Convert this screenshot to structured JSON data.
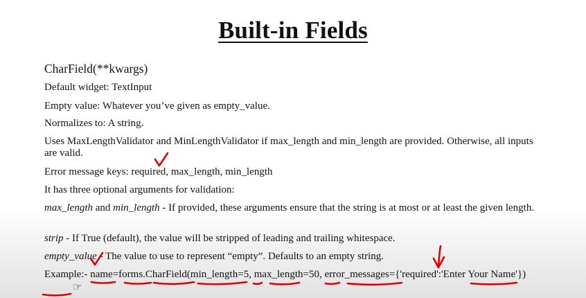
{
  "title": "Built-in Fields",
  "heading": "CharField(**kwargs)",
  "lines": {
    "widget": "Default widget: TextInput",
    "empty": "Empty value: Whatever you’ve given as empty_value.",
    "normalizes": "Normalizes to: A string.",
    "validators": "Uses MaxLengthValidator and MinLengthValidator if max_length and min_length are provided. Otherwise, all inputs are valid.",
    "error_keys": "Error message keys: required, max_length, min_length",
    "optional": "It has three optional arguments for validation:"
  },
  "args": {
    "max_length_term": "max_length",
    "and": " and ",
    "min_length_term": "min_length",
    "length_desc": " - If provided, these arguments ensure that the string is at most or at least the given length.",
    "strip_term": "strip",
    "strip_desc": " - If True (default), the value will be stripped of leading and trailing whitespace.",
    "empty_value_term": "empty_value",
    "empty_value_desc": " - The value to use to represent “empty”. Defaults to an empty string."
  },
  "example": "Example:- name=forms.CharField(min_length=5, max_length=50, error_messages={'required':'Enter Your Name'})",
  "annotation_color": "#e10000",
  "icons": [
    "checkmark-icon",
    "arrow-down-icon",
    "pointer-cursor-icon"
  ]
}
